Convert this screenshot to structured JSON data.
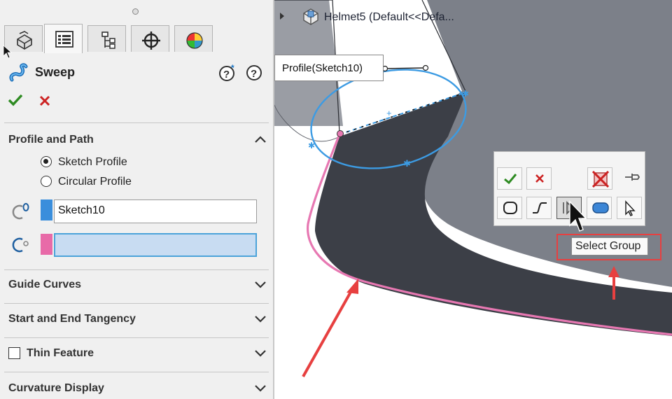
{
  "panel": {
    "tabs": [
      {
        "name": "feature-manager-icon"
      },
      {
        "name": "property-manager-icon"
      },
      {
        "name": "configuration-manager-icon"
      },
      {
        "name": "dimxpert-manager-icon"
      },
      {
        "name": "display-manager-icon"
      }
    ],
    "feature_title": "Sweep",
    "sections": {
      "profile_path": "Profile and Path",
      "guide_curves": "Guide Curves",
      "start_end_tangency": "Start and End Tangency",
      "thin_feature": "Thin Feature",
      "curvature_display": "Curvature Display"
    },
    "radio_options": [
      "Sketch Profile",
      "Circular Profile"
    ],
    "selected_radio": "Sketch Profile",
    "profile_field_value": "Sketch10",
    "path_field_value": "",
    "colors": {
      "profile_swatch": "#3a8edc",
      "path_swatch": "#e86aa8",
      "accept": "#2e8b22",
      "cancel": "#cc2222"
    }
  },
  "viewport": {
    "breadcrumb": "Helmet5  (Default<<Defa...",
    "profile_callout": "Profile(Sketch10)",
    "selection_toolbar": {
      "buttons_row1": [
        "ok-icon",
        "cancel-icon",
        "clear-selection-icon",
        "pin-icon"
      ],
      "buttons_row2": [
        "select-closed-loop-icon",
        "select-open-loop-icon",
        "select-group-icon",
        "select-region-icon",
        "select-pointer-icon"
      ]
    },
    "tooltip": "Select Group",
    "colors": {
      "annotation_red": "#e74040",
      "profile_blue": "#3c9be3",
      "path_pink": "#e778b2"
    }
  }
}
